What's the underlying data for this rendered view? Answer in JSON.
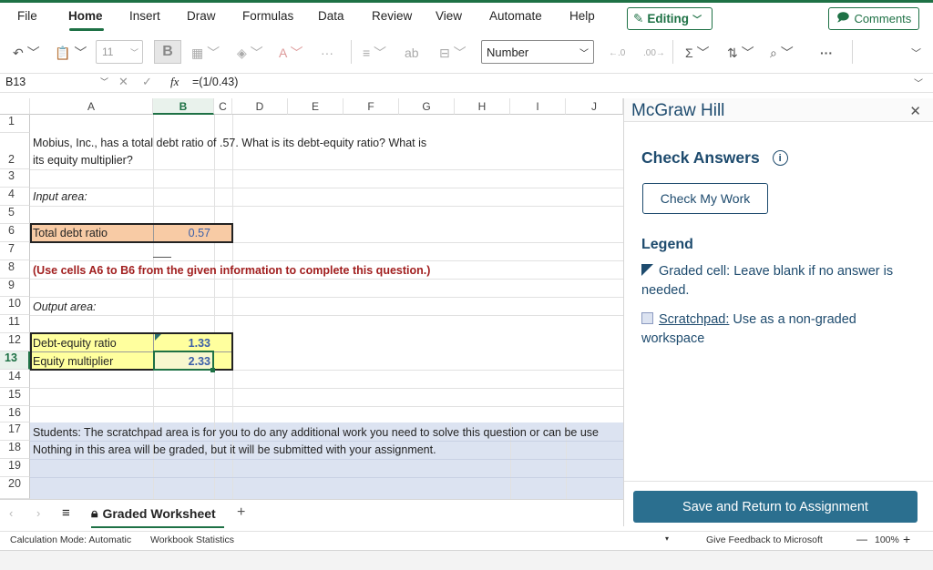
{
  "menu": {
    "items": [
      "File",
      "Home",
      "Insert",
      "Draw",
      "Formulas",
      "Data",
      "Review",
      "View",
      "Automate",
      "Help"
    ],
    "editing_label": "Editing",
    "comments_label": "Comments"
  },
  "ribbon": {
    "font_size": "11",
    "bold_label": "B",
    "number_format": "Number",
    "more_label": "···"
  },
  "formula_bar": {
    "name_box": "B13",
    "fx_label": "fx",
    "formula": "=(1/0.43)"
  },
  "grid": {
    "columns": [
      "A",
      "B",
      "C",
      "D",
      "E",
      "F",
      "G",
      "H",
      "I",
      "J"
    ],
    "rows": [
      "1",
      "2",
      "3",
      "4",
      "5",
      "6",
      "7",
      "8",
      "9",
      "10",
      "11",
      "12",
      "13",
      "14",
      "15",
      "16",
      "17",
      "18",
      "19",
      "20"
    ],
    "selected_column": "B",
    "selected_row": "13",
    "question_line1": "Mobius, Inc., has a total debt ratio of .57. What is its debt-equity ratio? What is",
    "question_line2": "its equity multiplier?",
    "input_area": "Input area:",
    "total_debt_label": "Total debt ratio",
    "total_debt_value": "0.57",
    "instruction": "(Use cells A6 to B6 from the given information to complete this question.)",
    "output_area": "Output area:",
    "de_ratio_label": "Debt-equity ratio",
    "de_ratio_value": "1.33",
    "equity_mult_label": "Equity multiplier",
    "equity_mult_value": "2.33",
    "scratch_line1": "Students: The scratchpad area is for you to do any additional work you need to solve this question or can be use",
    "scratch_line2": "Nothing in this area will be graded, but it will be submitted with your assignment."
  },
  "sheet_tabs": {
    "active": "Graded Worksheet",
    "add": "+",
    "menu": "≡"
  },
  "status": {
    "calc_mode": "Calculation Mode: Automatic",
    "workbook_stats": "Workbook Statistics",
    "feedback": "Give Feedback to Microsoft",
    "zoom": "100%"
  },
  "panel": {
    "title": "McGraw Hill",
    "check_answers": "Check Answers",
    "check_my_work": "Check My Work",
    "legend": "Legend",
    "graded_cell": "Graded cell: Leave blank if no answer is needed.",
    "scratchpad_link": "Scratchpad:",
    "scratchpad_text": " Use as a non-graded workspace",
    "save_button": "Save and Return to Assignment"
  }
}
